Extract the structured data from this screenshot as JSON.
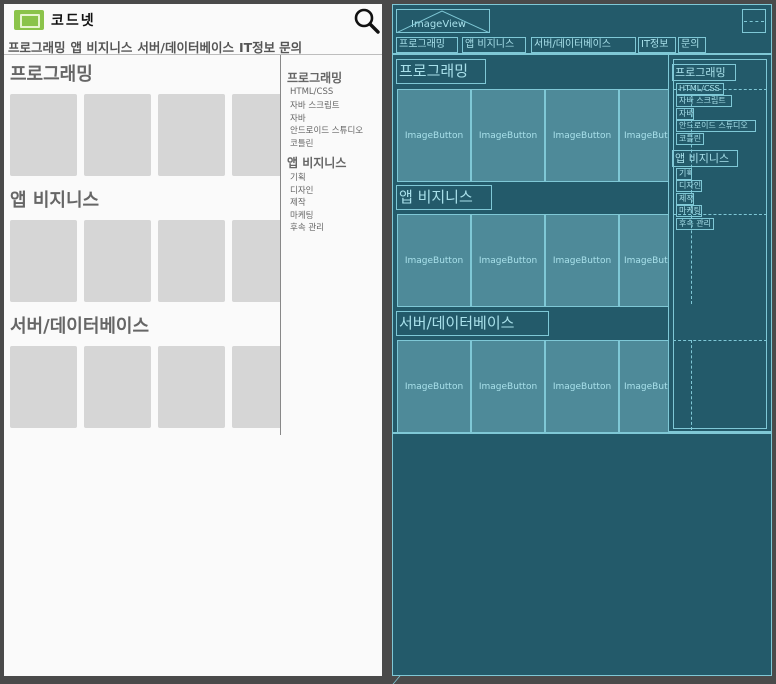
{
  "app": {
    "name": "코드넷",
    "categories": [
      "프로그래밍",
      "앱 비지니스",
      "서버/데이터베이스",
      "IT정보",
      "문의"
    ],
    "sections": [
      {
        "title": "프로그래밍"
      },
      {
        "title": "앱 비지니스"
      },
      {
        "title": "서버/데이터베이스"
      }
    ],
    "drawer": {
      "groups": [
        {
          "title": "프로그래밍",
          "items": [
            "HTML/CSS",
            "자바 스크립트",
            "자바",
            "안드로이드 스튜디오",
            "코틀린"
          ]
        },
        {
          "title": "앱 비지니스",
          "items": [
            "기획",
            "디자인",
            "제작",
            "마케팅",
            "후속 관리"
          ]
        }
      ]
    }
  },
  "blueprint": {
    "image_view_label": "ImageView",
    "image_button_label": "ImageButton",
    "image_button_cut_label": "ImageBut",
    "categories": [
      "프로그래밍",
      "앱 비지니스",
      "서버/데이터베이스",
      "IT정보",
      "문의"
    ],
    "sections": [
      "프로그래밍",
      "앱 비지니스",
      "서버/데이터베이스"
    ],
    "drawer_groups": [
      {
        "title": "프로그래밍",
        "items": [
          "HTML/CSS",
          "자바 스크립트",
          "자바",
          "안드로이드 스튜디오",
          "코틀린"
        ]
      },
      {
        "title": "앱 비지니스",
        "items": [
          "기획",
          "디자인",
          "제작",
          "마케팅",
          "후속 관리"
        ]
      }
    ]
  },
  "colors": {
    "logo": "#8bc34a",
    "thumb": "#d6d6d6",
    "blueprint_bg": "#235a6a",
    "blueprint_line": "#7fc8d6"
  }
}
